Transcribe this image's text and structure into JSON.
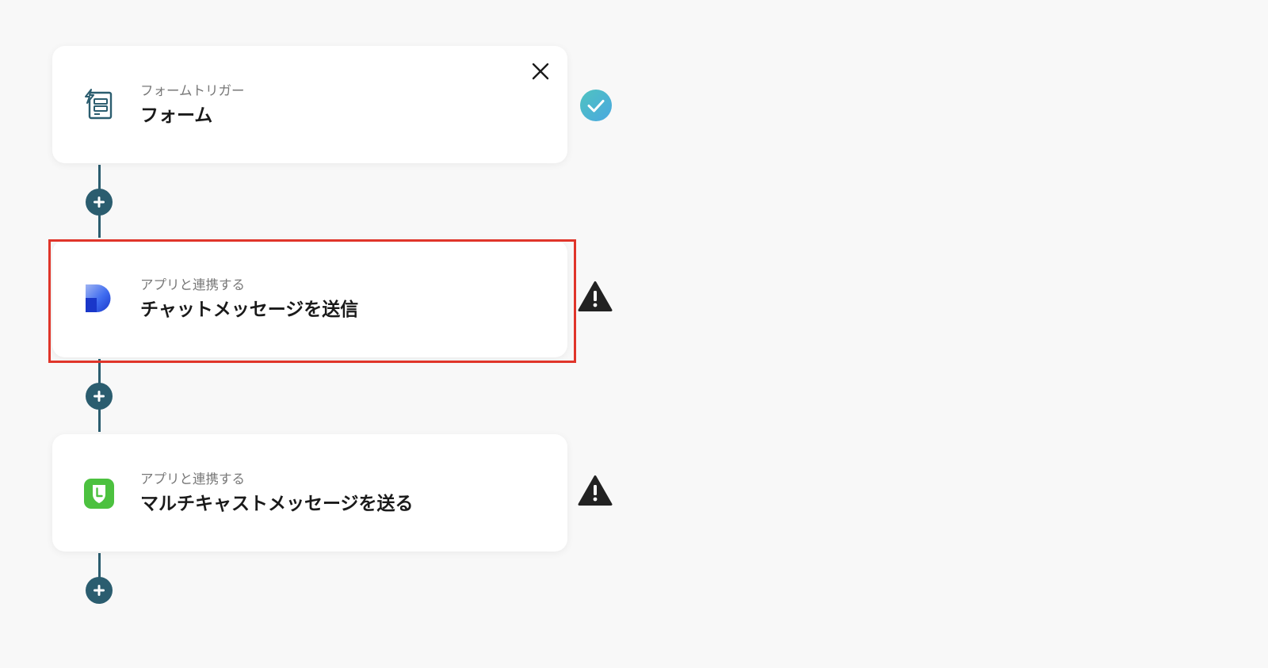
{
  "steps": [
    {
      "subtitle": "フォームトリガー",
      "title": "フォーム",
      "icon": "form-trigger-icon",
      "status": "complete"
    },
    {
      "subtitle": "アプリと連携する",
      "title": "チャットメッセージを送信",
      "icon": "chat-app-logo-icon",
      "status": "warning",
      "highlighted": true
    },
    {
      "subtitle": "アプリと連携する",
      "title": "マルチキャストメッセージを送る",
      "icon": "line-app-logo-icon",
      "status": "warning"
    }
  ],
  "colors": {
    "connector": "#2b5d6f",
    "highlight": "#e0352a",
    "check_start": "#4fc3c0",
    "check_end": "#4aa8e0",
    "warning": "#222222",
    "line_green": "#4cc13f"
  }
}
